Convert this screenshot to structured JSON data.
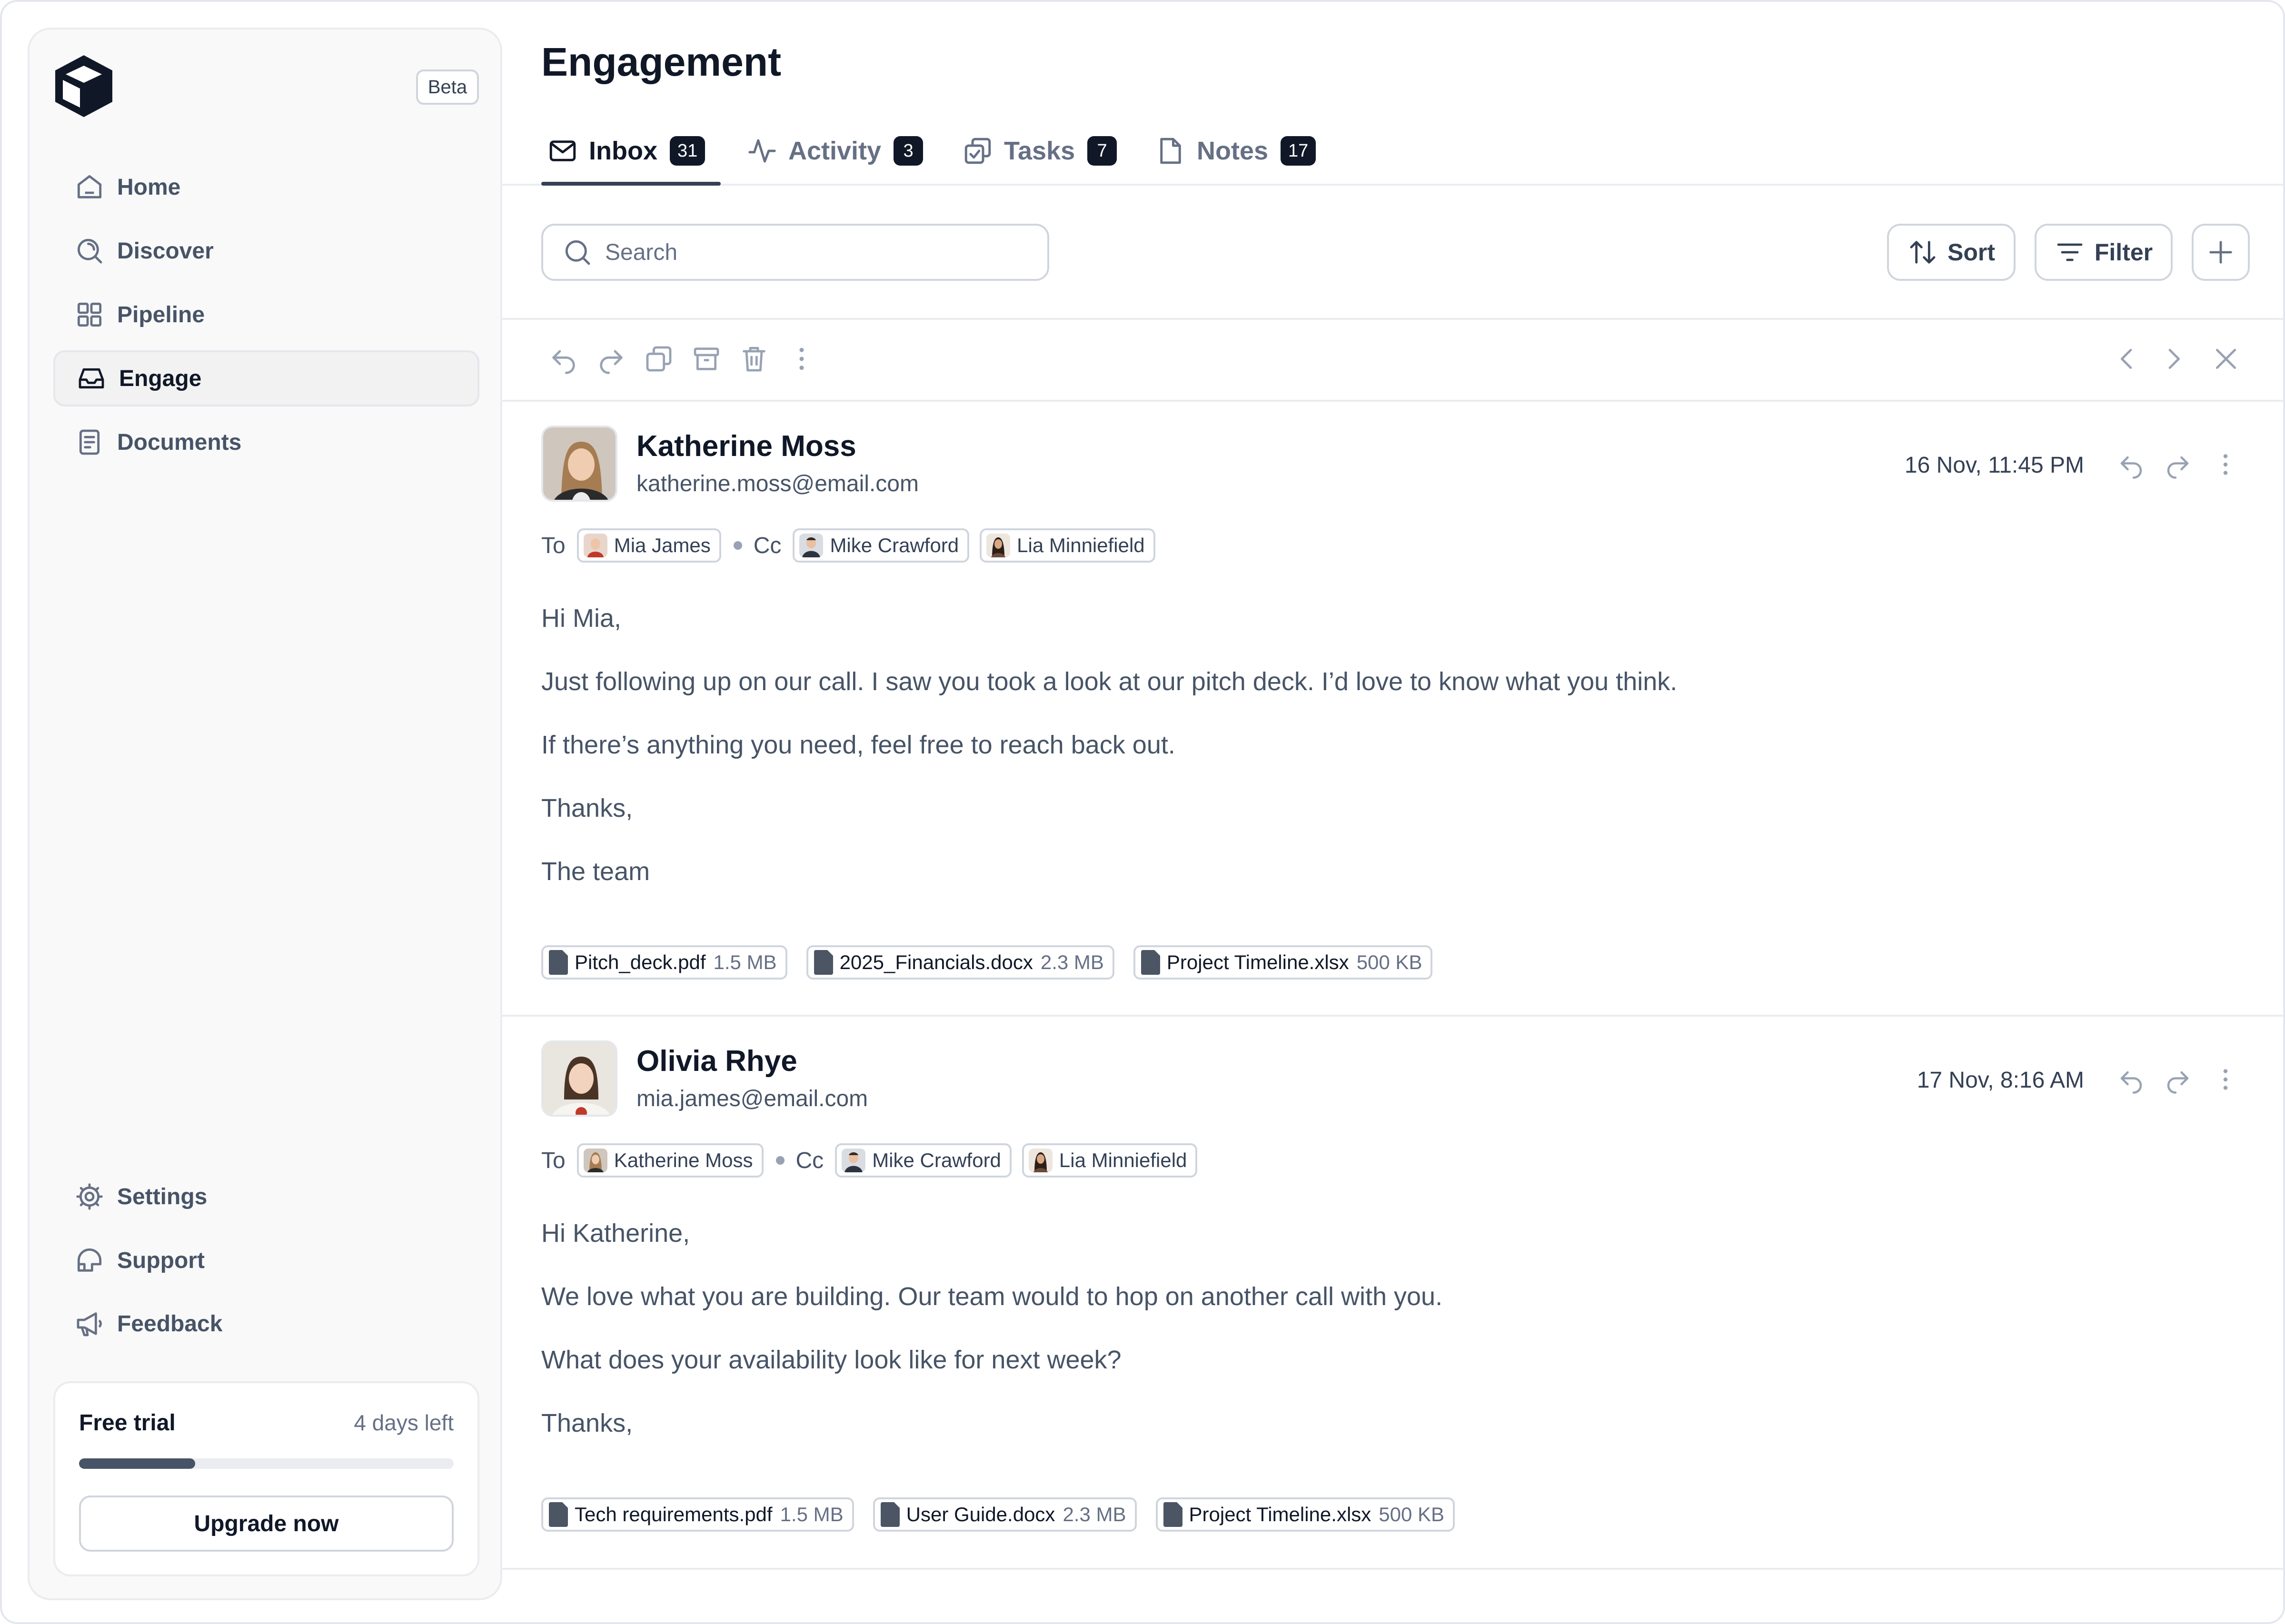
{
  "sidebar": {
    "beta": "Beta",
    "nav": [
      {
        "label": "Home",
        "icon": "home-icon"
      },
      {
        "label": "Discover",
        "icon": "discover-icon"
      },
      {
        "label": "Pipeline",
        "icon": "grid-icon"
      },
      {
        "label": "Engage",
        "icon": "inbox-icon",
        "active": true
      },
      {
        "label": "Documents",
        "icon": "document-icon"
      }
    ],
    "bottom_nav": [
      {
        "label": "Settings",
        "icon": "gear-icon"
      },
      {
        "label": "Support",
        "icon": "support-icon"
      },
      {
        "label": "Feedback",
        "icon": "megaphone-icon"
      }
    ],
    "trial": {
      "title": "Free trial",
      "days": "4 days left",
      "progress": 0.31,
      "button": "Upgrade now"
    }
  },
  "header": {
    "title": "Engagement"
  },
  "tabs": [
    {
      "label": "Inbox",
      "count": "31",
      "icon": "mail-icon",
      "active": true
    },
    {
      "label": "Activity",
      "count": "3",
      "icon": "activity-icon"
    },
    {
      "label": "Tasks",
      "count": "7",
      "icon": "tasks-icon"
    },
    {
      "label": "Notes",
      "count": "17",
      "icon": "notes-icon"
    }
  ],
  "toolbar": {
    "search_placeholder": "Search",
    "sort_label": "Sort",
    "filter_label": "Filter"
  },
  "emails": [
    {
      "sender": "Katherine Moss",
      "email": "katherine.moss@email.com",
      "time": "16 Nov, 11:45 PM",
      "to_label": "To",
      "cc_label": "Cc",
      "to": [
        "Mia James"
      ],
      "cc": [
        "Mike Crawford",
        "Lia Minniefield"
      ],
      "body": [
        "Hi Mia,",
        "Just following up on our call. I saw you took a look at our pitch deck. I’d love to know what you think.",
        "If there’s anything you need, feel free to reach back out.",
        "Thanks,",
        "The team"
      ],
      "attachments": [
        {
          "name": "Pitch_deck.pdf",
          "size": "1.5 MB"
        },
        {
          "name": "2025_Financials.docx",
          "size": "2.3 MB"
        },
        {
          "name": "Project Timeline.xlsx",
          "size": "500 KB"
        }
      ]
    },
    {
      "sender": "Olivia Rhye",
      "email": "mia.james@email.com",
      "time": "17 Nov, 8:16 AM",
      "to_label": "To",
      "cc_label": "Cc",
      "to": [
        "Katherine Moss"
      ],
      "cc": [
        "Mike Crawford",
        "Lia Minniefield"
      ],
      "body": [
        "Hi Katherine,",
        "We love what you are building. Our team would to hop on another call with you.",
        "What does your availability look like for next week?",
        "Thanks,"
      ],
      "attachments": [
        {
          "name": "Tech requirements.pdf",
          "size": "1.5 MB"
        },
        {
          "name": "User Guide.docx",
          "size": "2.3 MB"
        },
        {
          "name": "Project Timeline.xlsx",
          "size": "500 KB"
        }
      ]
    }
  ]
}
